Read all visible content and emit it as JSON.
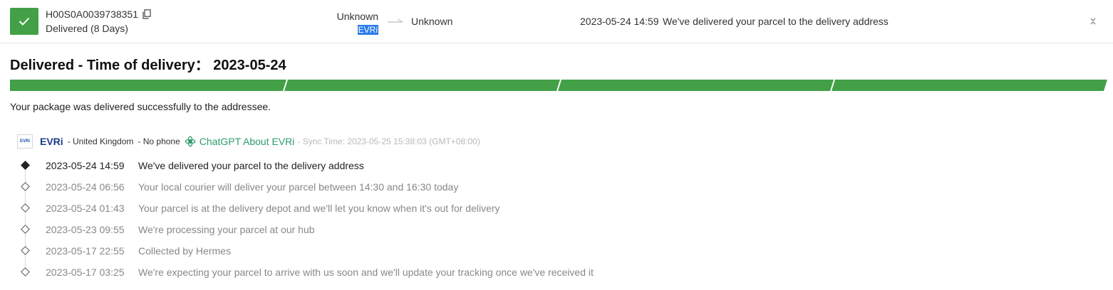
{
  "shipment": {
    "tracking_number": "H00S0A0039738351",
    "status": "Delivered (8 Days)",
    "origin_country": "Unknown",
    "origin_carrier": "EVRi",
    "destination_country": "Unknown",
    "latest_event_time": "2023-05-24 14:59",
    "latest_event_desc": "We've delivered your parcel to the delivery address"
  },
  "colors": {
    "delivered_green": "#43a047",
    "chatgpt_green": "#2e9b6a",
    "carrier_blue": "#1a3b8a"
  },
  "detail": {
    "title": "Delivered - Time of delivery： 2023-05-24",
    "progress_segments_complete": 4,
    "progress_segments_total": 4,
    "summary": "Your package was delivered successfully to the addressee."
  },
  "carrier": {
    "logo_text": "EVRi",
    "name": "EVRi",
    "country": "- United Kingdom",
    "phone": "- No phone",
    "chatgpt_label": "ChatGPT About EVRi",
    "sync_time": "- Sync Time: 2023-05-25 15:38:03 (GMT+08:00)"
  },
  "events": [
    {
      "time": "2023-05-24 14:59",
      "desc": "We've delivered your parcel to the delivery address"
    },
    {
      "time": "2023-05-24 06:56",
      "desc": "Your local courier will deliver your parcel between 14:30 and 16:30 today"
    },
    {
      "time": "2023-05-24 01:43",
      "desc": "Your parcel is at the delivery depot and we'll let you know when it's out for delivery"
    },
    {
      "time": "2023-05-23 09:55",
      "desc": "We're processing your parcel at our hub"
    },
    {
      "time": "2023-05-17 22:55",
      "desc": "Collected by Hermes"
    },
    {
      "time": "2023-05-17 03:25",
      "desc": "We're expecting your parcel to arrive with us soon and we'll update your tracking once we've received it"
    }
  ],
  "icons": [
    "check-icon",
    "copy-icon",
    "arrow-right-icon",
    "collapse-icon",
    "chatgpt-icon",
    "timeline-diamond-icon"
  ]
}
